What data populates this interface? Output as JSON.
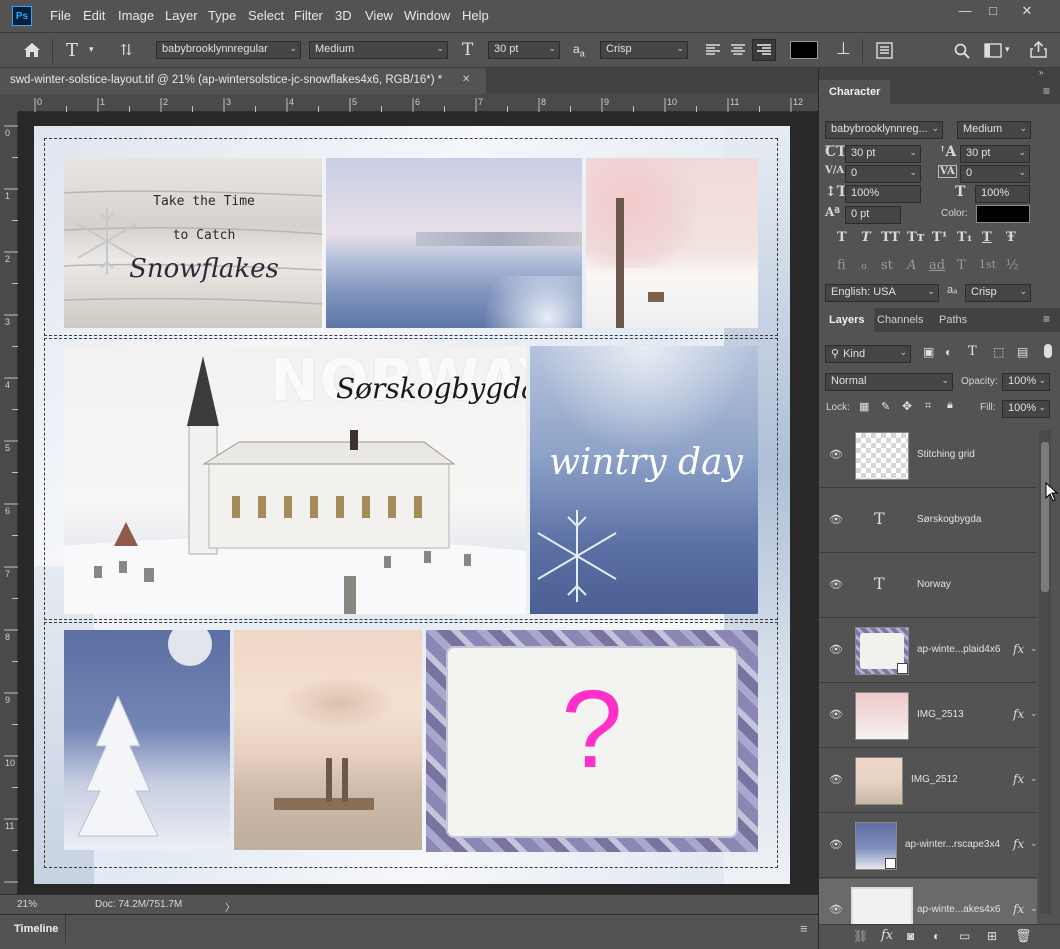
{
  "menubar": {
    "logo": "Ps",
    "items": [
      "File",
      "Edit",
      "Image",
      "Layer",
      "Type",
      "Select",
      "Filter",
      "3D",
      "View",
      "Window",
      "Help"
    ],
    "window_controls": [
      "—",
      "□",
      "✕"
    ]
  },
  "options": {
    "font_family": "babybrooklynnregular",
    "font_style": "Medium",
    "font_size": "30 pt",
    "aa_label": "a",
    "aa_label_sub": "a",
    "anti_alias": "Crisp",
    "text_color": "#000000"
  },
  "document": {
    "tab_title": "swd-winter-solstice-layout.tif @ 21% (ap-wintersolstice-jc-snowflakes4x6, RGB/16*) *",
    "tab_close": "✕"
  },
  "rulers": {
    "h_labels": [
      "0",
      "1",
      "2",
      "3",
      "4",
      "5",
      "6",
      "7",
      "8",
      "9",
      "10",
      "11",
      "12"
    ],
    "v_labels": [
      "0",
      "1",
      "2",
      "3",
      "4",
      "5",
      "6",
      "7",
      "8",
      "9",
      "10",
      "11"
    ]
  },
  "canvas": {
    "card_line1": "Take the Time",
    "card_line2": "to Catch",
    "card_line3": "Snowflakes",
    "norway": "NORWAY",
    "sorskogbygda": "Sørskogbygda",
    "wintry": "wintry day",
    "question": "?",
    "question_color": "#ff2fc8"
  },
  "status": {
    "zoom": "21%",
    "doc": "Doc: 74.2M/751.7M",
    "arrow": "〉"
  },
  "timeline": {
    "label": "Timeline",
    "menu": "≡"
  },
  "character_panel": {
    "title": "Character",
    "font_family": "babybrooklynnreg...",
    "font_style": "Medium",
    "size": "30 pt",
    "leading": "30 pt",
    "kerning": "0",
    "tracking": "0",
    "vscale": "100%",
    "hscale": "100%",
    "baseline": "0 pt",
    "color_label": "Color:",
    "color": "#000000",
    "language": "English: USA",
    "aa": "Crisp",
    "style_glyphs": [
      "T",
      "T",
      "TT",
      "Tт",
      "T¹",
      "T₁",
      "T",
      "Ŧ"
    ],
    "ot_glyphs": [
      "fi",
      "ℴ",
      "st",
      "A",
      "ad",
      "T",
      "1st",
      "½"
    ]
  },
  "layers_panel": {
    "tabs": [
      "Layers",
      "Channels",
      "Paths"
    ],
    "filter_kind": "Kind",
    "blend_mode": "Normal",
    "opacity_label": "Opacity:",
    "opacity": "100%",
    "lock_label": "Lock:",
    "fill_label": "Fill:",
    "fill": "100%",
    "layers": [
      {
        "name": "Stitching grid",
        "kind": "pixel"
      },
      {
        "name": "Sørskogbygda",
        "kind": "text"
      },
      {
        "name": "Norway",
        "kind": "text"
      },
      {
        "name": "ap-winte...plaid4x6",
        "kind": "smart",
        "fx": "fx"
      },
      {
        "name": "IMG_2513",
        "kind": "photo",
        "fx": "fx"
      },
      {
        "name": "IMG_2512",
        "kind": "photo",
        "fx": "fx"
      },
      {
        "name": "ap-winter...rscape3x4",
        "kind": "smart",
        "fx": "fx"
      },
      {
        "name": "ap-winte...akes4x6",
        "kind": "smart",
        "fx": "fx"
      }
    ],
    "text_glyph": "T"
  }
}
